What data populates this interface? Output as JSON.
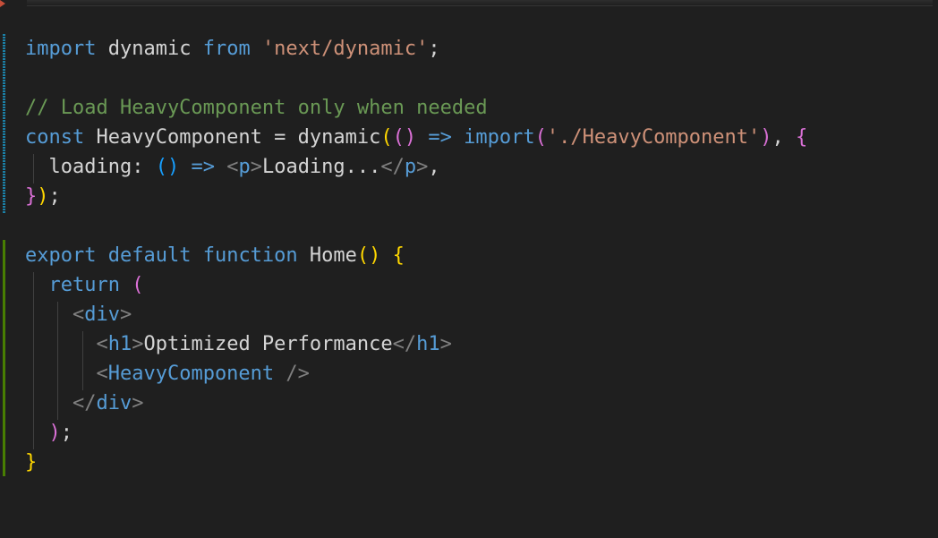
{
  "editor": {
    "language": "javascript-react",
    "lines": [
      {
        "tokens": [
          {
            "text": "import",
            "kind": "kw"
          },
          {
            "text": " dynamic ",
            "kind": "plain"
          },
          {
            "text": "from",
            "kind": "kw"
          },
          {
            "text": " ",
            "kind": "plain"
          },
          {
            "text": "'next/dynamic'",
            "kind": "str"
          },
          {
            "text": ";",
            "kind": "punct"
          }
        ]
      },
      {
        "tokens": []
      },
      {
        "tokens": [
          {
            "text": "// Load HeavyComponent only when needed",
            "kind": "comment"
          }
        ]
      },
      {
        "tokens": [
          {
            "text": "const",
            "kind": "kw"
          },
          {
            "text": " HeavyComponent = ",
            "kind": "plain"
          },
          {
            "text": "dynamic",
            "kind": "plain"
          },
          {
            "text": "(",
            "kind": "brace-gold"
          },
          {
            "text": "()",
            "kind": "brace-violet"
          },
          {
            "text": " ",
            "kind": "plain"
          },
          {
            "text": "=>",
            "kind": "kw"
          },
          {
            "text": " ",
            "kind": "plain"
          },
          {
            "text": "import",
            "kind": "kw"
          },
          {
            "text": "(",
            "kind": "brace-violet"
          },
          {
            "text": "'./HeavyComponent'",
            "kind": "str"
          },
          {
            "text": ")",
            "kind": "brace-violet"
          },
          {
            "text": ", ",
            "kind": "punct"
          },
          {
            "text": "{",
            "kind": "brace-violet"
          }
        ]
      },
      {
        "tokens": [
          {
            "text": "  loading: ",
            "kind": "plain"
          },
          {
            "text": "()",
            "kind": "brace-blue"
          },
          {
            "text": " ",
            "kind": "plain"
          },
          {
            "text": "=>",
            "kind": "kw"
          },
          {
            "text": " ",
            "kind": "plain"
          },
          {
            "text": "<",
            "kind": "tag-bracket"
          },
          {
            "text": "p",
            "kind": "tag"
          },
          {
            "text": ">",
            "kind": "tag-bracket"
          },
          {
            "text": "Loading...",
            "kind": "plain"
          },
          {
            "text": "</",
            "kind": "tag-bracket"
          },
          {
            "text": "p",
            "kind": "tag"
          },
          {
            "text": ">",
            "kind": "tag-bracket"
          },
          {
            "text": ",",
            "kind": "punct"
          }
        ]
      },
      {
        "tokens": [
          {
            "text": "}",
            "kind": "brace-violet"
          },
          {
            "text": ")",
            "kind": "brace-gold"
          },
          {
            "text": ";",
            "kind": "punct"
          }
        ]
      },
      {
        "tokens": []
      },
      {
        "tokens": [
          {
            "text": "export",
            "kind": "kw"
          },
          {
            "text": " ",
            "kind": "plain"
          },
          {
            "text": "default",
            "kind": "kw"
          },
          {
            "text": " ",
            "kind": "plain"
          },
          {
            "text": "function",
            "kind": "kw"
          },
          {
            "text": " ",
            "kind": "plain"
          },
          {
            "text": "Home",
            "kind": "plain"
          },
          {
            "text": "()",
            "kind": "brace-gold"
          },
          {
            "text": " ",
            "kind": "plain"
          },
          {
            "text": "{",
            "kind": "brace-gold"
          }
        ]
      },
      {
        "tokens": [
          {
            "text": "  ",
            "kind": "plain"
          },
          {
            "text": "return",
            "kind": "kw"
          },
          {
            "text": " ",
            "kind": "plain"
          },
          {
            "text": "(",
            "kind": "brace-violet"
          }
        ]
      },
      {
        "tokens": [
          {
            "text": "    ",
            "kind": "plain"
          },
          {
            "text": "<",
            "kind": "tag-bracket"
          },
          {
            "text": "div",
            "kind": "tag"
          },
          {
            "text": ">",
            "kind": "tag-bracket"
          }
        ]
      },
      {
        "tokens": [
          {
            "text": "      ",
            "kind": "plain"
          },
          {
            "text": "<",
            "kind": "tag-bracket"
          },
          {
            "text": "h1",
            "kind": "tag"
          },
          {
            "text": ">",
            "kind": "tag-bracket"
          },
          {
            "text": "Optimized Performance",
            "kind": "plain"
          },
          {
            "text": "</",
            "kind": "tag-bracket"
          },
          {
            "text": "h1",
            "kind": "tag"
          },
          {
            "text": ">",
            "kind": "tag-bracket"
          }
        ]
      },
      {
        "tokens": [
          {
            "text": "      ",
            "kind": "plain"
          },
          {
            "text": "<",
            "kind": "tag-bracket"
          },
          {
            "text": "HeavyComponent",
            "kind": "tag"
          },
          {
            "text": " />",
            "kind": "tag-bracket"
          }
        ]
      },
      {
        "tokens": [
          {
            "text": "    ",
            "kind": "plain"
          },
          {
            "text": "</",
            "kind": "tag-bracket"
          },
          {
            "text": "div",
            "kind": "tag"
          },
          {
            "text": ">",
            "kind": "tag-bracket"
          }
        ]
      },
      {
        "tokens": [
          {
            "text": "  ",
            "kind": "plain"
          },
          {
            "text": ")",
            "kind": "brace-violet"
          },
          {
            "text": ";",
            "kind": "punct"
          }
        ]
      },
      {
        "tokens": [
          {
            "text": "}",
            "kind": "brace-gold"
          }
        ]
      }
    ]
  },
  "colors": {
    "background": "#1f1f1f",
    "keyword": "#569cd6",
    "string": "#ce9178",
    "comment": "#6a9955",
    "plain_text": "#d4d4d4",
    "bracket_level_1": "#ffd700",
    "bracket_level_2": "#da70d6",
    "bracket_level_3": "#179fff",
    "tag_bracket": "#808080",
    "gutter_modified": "#1b81a8",
    "gutter_added": "#487e02"
  }
}
